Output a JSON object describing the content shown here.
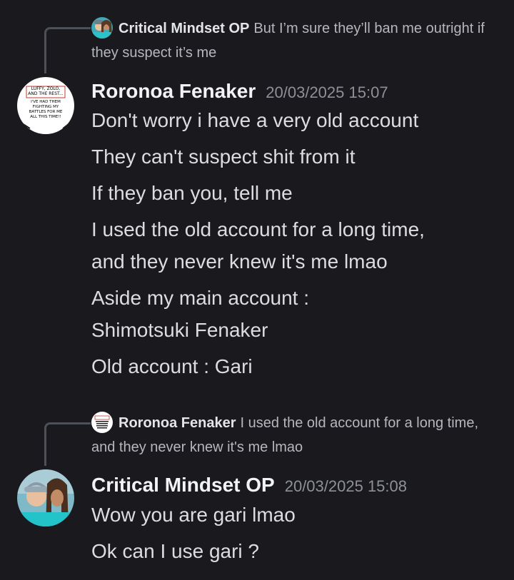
{
  "thread": [
    {
      "reply_to": {
        "author": "Critical Mindset OP",
        "text": "But I’m sure they’ll ban me outright if they suspect it’s me"
      },
      "author": "Roronoa Fenaker",
      "timestamp": "20/03/2025 15:07",
      "avatar_caption": [
        "LUFFY, ZOLO,",
        "AND THE REST...",
        "I'VE HAD THEM",
        "FIGHTING MY",
        "BATTLES FOR ME",
        "ALL THIS TIME!!"
      ],
      "lines": [
        "Don't worry i have a very old account",
        "They can't suspect shit from it",
        "If they ban you, tell me",
        "I used the old account for a long time,",
        "and they never knew it's me lmao",
        "Aside my main account :",
        "Shimotsuki Fenaker",
        "Old account : Gari"
      ]
    },
    {
      "reply_to": {
        "author": "Roronoa Fenaker",
        "text": "I used the old account for a long time, and they never knew it's me lmao"
      },
      "author": "Critical Mindset OP",
      "timestamp": "20/03/2025 15:08",
      "lines": [
        "Wow you are gari lmao",
        "Ok can I use gari ?"
      ]
    }
  ]
}
